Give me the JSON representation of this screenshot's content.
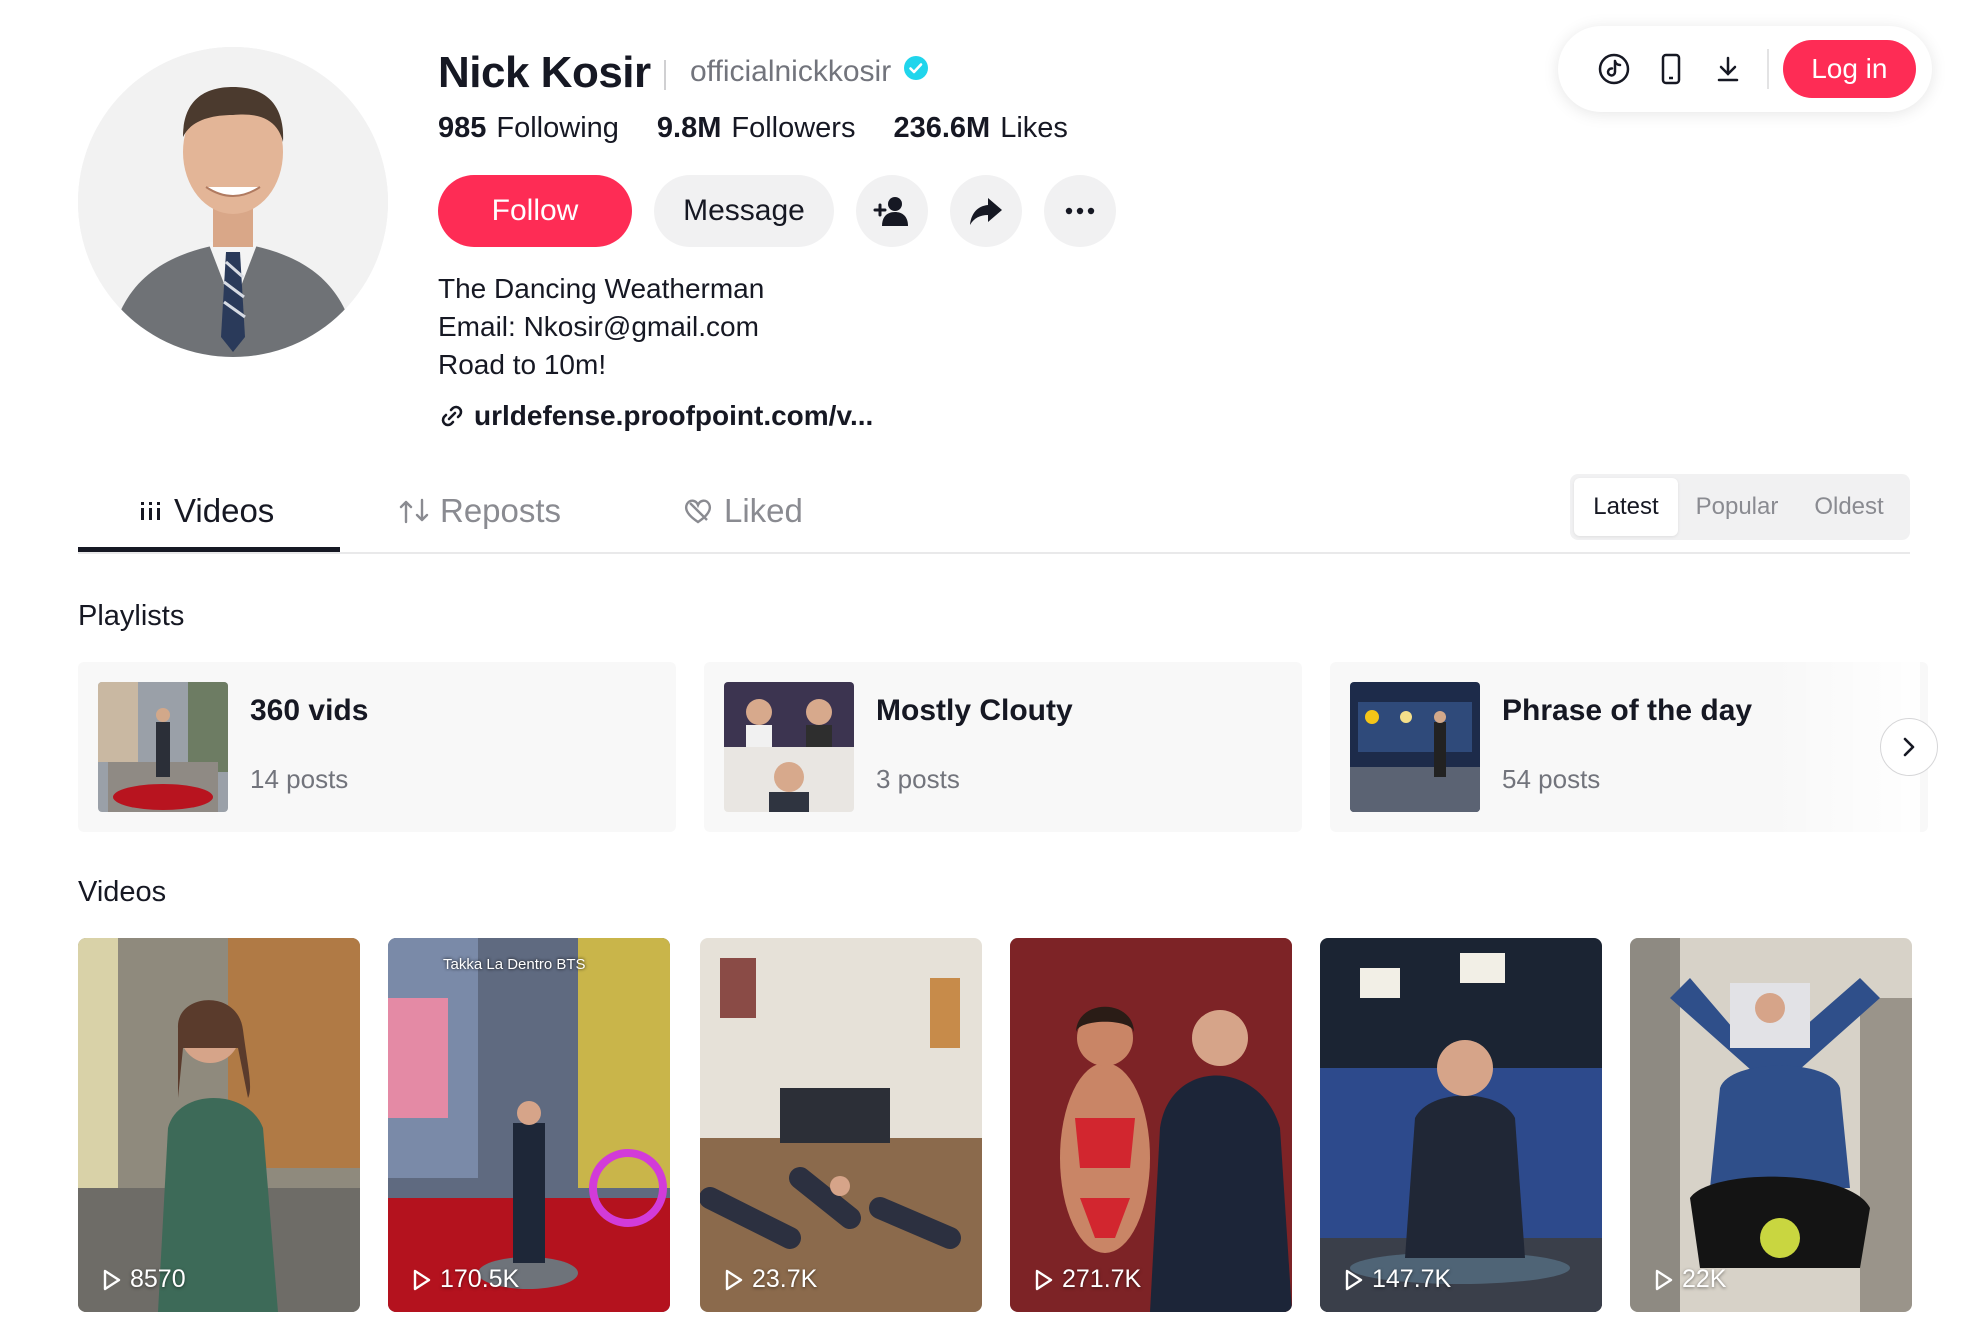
{
  "header": {
    "login_label": "Log in",
    "icons": [
      "tiktok-logo-icon",
      "mobile-phone-icon",
      "download-icon"
    ]
  },
  "profile": {
    "name": "Nick Kosir",
    "username": "officialnickkosir",
    "verified": true,
    "stats": [
      {
        "value": "985",
        "label": "Following"
      },
      {
        "value": "9.8M",
        "label": "Followers"
      },
      {
        "value": "236.6M",
        "label": "Likes"
      }
    ],
    "follow_label": "Follow",
    "message_label": "Message",
    "bio": [
      "The Dancing Weatherman",
      "Email: Nkosir@gmail.com",
      "Road to 10m!"
    ],
    "link": "urldefense.proofpoint.com/v..."
  },
  "tabs": [
    {
      "label": "Videos",
      "active": true
    },
    {
      "label": "Reposts",
      "active": false
    },
    {
      "label": "Liked",
      "active": false
    }
  ],
  "sort": {
    "options": [
      "Latest",
      "Popular",
      "Oldest"
    ],
    "selected": "Latest"
  },
  "playlists": {
    "title": "Playlists",
    "items": [
      {
        "title": "360 vids",
        "count": "14 posts"
      },
      {
        "title": "Mostly Clouty",
        "count": "3 posts"
      },
      {
        "title": "Phrase of the day",
        "count": "54 posts"
      }
    ]
  },
  "videos": {
    "title": "Videos",
    "items": [
      {
        "views": "8570"
      },
      {
        "views": "170.5K",
        "caption": "Takka La Dentro BTS"
      },
      {
        "views": "23.7K"
      },
      {
        "views": "271.7K"
      },
      {
        "views": "147.7K"
      },
      {
        "views": "22K"
      }
    ]
  },
  "colors": {
    "brand": "#fe2c55",
    "verified": "#20d5ec",
    "text": "#161823",
    "muted": "#72747c"
  }
}
